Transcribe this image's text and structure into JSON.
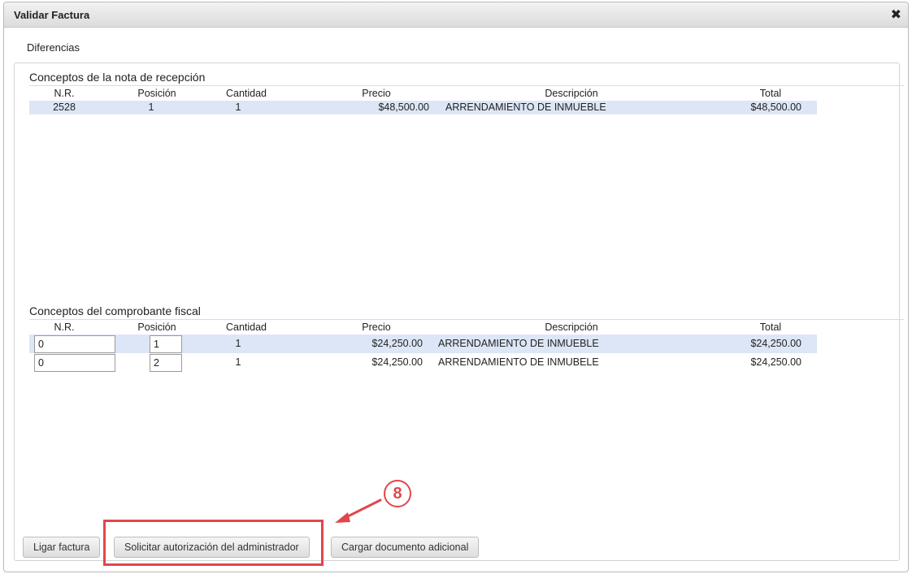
{
  "dialog": {
    "title": "Validar Factura",
    "close_glyph": "✖",
    "tab_label": "Diferencias"
  },
  "reception": {
    "title": "Conceptos de la nota de recepción",
    "headers": [
      "N.R.",
      "Posición",
      "Cantidad",
      "Precio",
      "Descripción",
      "Total"
    ],
    "rows": [
      {
        "nr": "2528",
        "posicion": "1",
        "cantidad": "1",
        "precio": "$48,500.00",
        "descripcion": "ARRENDAMIENTO DE INMUEBLE",
        "total": "$48,500.00"
      }
    ]
  },
  "fiscal": {
    "title": "Conceptos del comprobante fiscal",
    "headers": [
      "N.R.",
      "Posición",
      "Cantidad",
      "Precio",
      "Descripción",
      "Total"
    ],
    "rows": [
      {
        "nr": "0",
        "posicion": "1",
        "cantidad": "1",
        "precio": "$24,250.00",
        "descripcion": "ARRENDAMIENTO DE INMUEBLE",
        "total": "$24,250.00"
      },
      {
        "nr": "0",
        "posicion": "2",
        "cantidad": "1",
        "precio": "$24,250.00",
        "descripcion": "ARRENDAMIENTO DE INMUBELE",
        "total": "$24,250.00"
      }
    ]
  },
  "buttons": {
    "ligar": "Ligar factura",
    "solicitar": "Solicitar autorización del administrador",
    "cargar": "Cargar documento adicional"
  },
  "annotation": {
    "step": "8",
    "color": "#e0474c"
  },
  "colors": {
    "selected_row": "#dde6f6"
  }
}
